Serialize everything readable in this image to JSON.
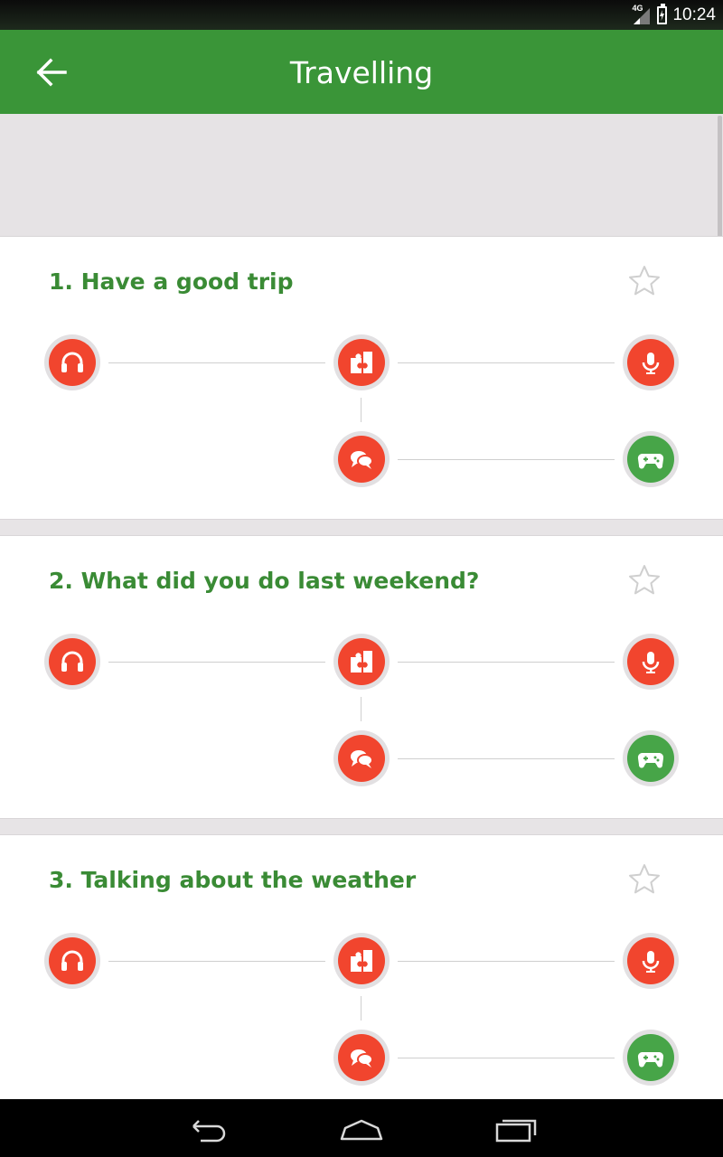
{
  "status_bar": {
    "time": "10:24",
    "network": "4G"
  },
  "app_bar": {
    "title": "Travelling"
  },
  "lessons": [
    {
      "title": "1. Have a good trip"
    },
    {
      "title": "2. What did you do last weekend?"
    },
    {
      "title": "3. Talking about the weather"
    }
  ],
  "activity_icons": [
    "headphones-icon",
    "puzzle-icon",
    "microphone-icon",
    "chat-bubbles-icon",
    "gamepad-icon"
  ],
  "colors": {
    "app_bar": "#3a9538",
    "lesson_title": "#3a8b35",
    "activity_red": "#f1452e",
    "activity_green": "#47a548"
  }
}
